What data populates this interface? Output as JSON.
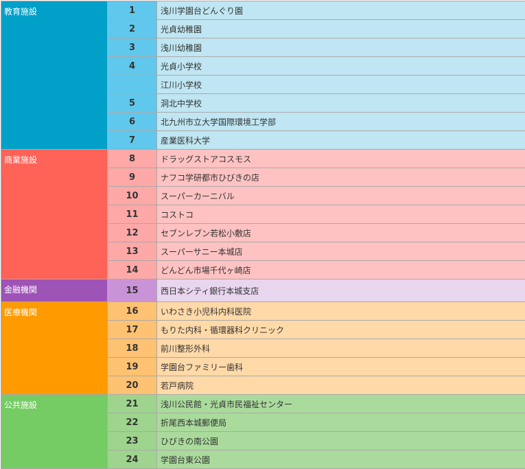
{
  "groups": [
    {
      "category": "教育施設",
      "colors": {
        "cat": "#00a0c8",
        "num": "#60c8ec",
        "name": "#bfe6f2"
      },
      "rows": [
        {
          "no": "1",
          "name": "浅川学園台どんぐり園"
        },
        {
          "no": "2",
          "name": "光貞幼稚園"
        },
        {
          "no": "3",
          "name": "浅川幼稚園"
        },
        {
          "no": "4",
          "name": "光貞小学校"
        },
        {
          "no": "",
          "name": "江川小学校"
        },
        {
          "no": "5",
          "name": "洞北中学校"
        },
        {
          "no": "6",
          "name": "北九州市立大学国際環境工学部"
        },
        {
          "no": "7",
          "name": "産業医科大学"
        }
      ]
    },
    {
      "category": "商業施設",
      "colors": {
        "cat": "#ff6257",
        "num": "#ffa8a8",
        "name": "#ffc2c2"
      },
      "rows": [
        {
          "no": "8",
          "name": "ドラッグストアコスモス"
        },
        {
          "no": "9",
          "name": "ナフコ学研都市ひびきの店"
        },
        {
          "no": "10",
          "name": "スーパーカーニバル"
        },
        {
          "no": "11",
          "name": "コストコ"
        },
        {
          "no": "12",
          "name": "セブンレブン若松小敷店"
        },
        {
          "no": "13",
          "name": "スーパーサニー本城店"
        },
        {
          "no": "14",
          "name": "どんどん市場千代ヶ崎店"
        }
      ]
    },
    {
      "category": "金融機関",
      "colors": {
        "cat": "#9e53b7",
        "num": "#c993d8",
        "name": "#e8d5ee"
      },
      "rows": [
        {
          "no": "15",
          "name": "西日本シティ銀行本城支店"
        }
      ]
    },
    {
      "category": "医療機関",
      "colors": {
        "cat": "#ff9a00",
        "num": "#ffc172",
        "name": "#ffd9a8"
      },
      "rows": [
        {
          "no": "16",
          "name": "いわさき小児科内科医院"
        },
        {
          "no": "17",
          "name": "もりた内科・循環器科クリニック"
        },
        {
          "no": "18",
          "name": "前川整形外科"
        },
        {
          "no": "19",
          "name": "学園台ファミリー歯科"
        },
        {
          "no": "20",
          "name": "若戸病院"
        }
      ]
    },
    {
      "category": "公共施設",
      "colors": {
        "cat": "#75cb64",
        "num": "#9ed48d",
        "name": "#aadb9c"
      },
      "rows": [
        {
          "no": "21",
          "name": "浅川公民館・光貞市民福祉センター"
        },
        {
          "no": "22",
          "name": "折尾西本城郵便局"
        },
        {
          "no": "23",
          "name": "ひびきの南公園"
        },
        {
          "no": "24",
          "name": "学園台東公園"
        }
      ]
    }
  ]
}
